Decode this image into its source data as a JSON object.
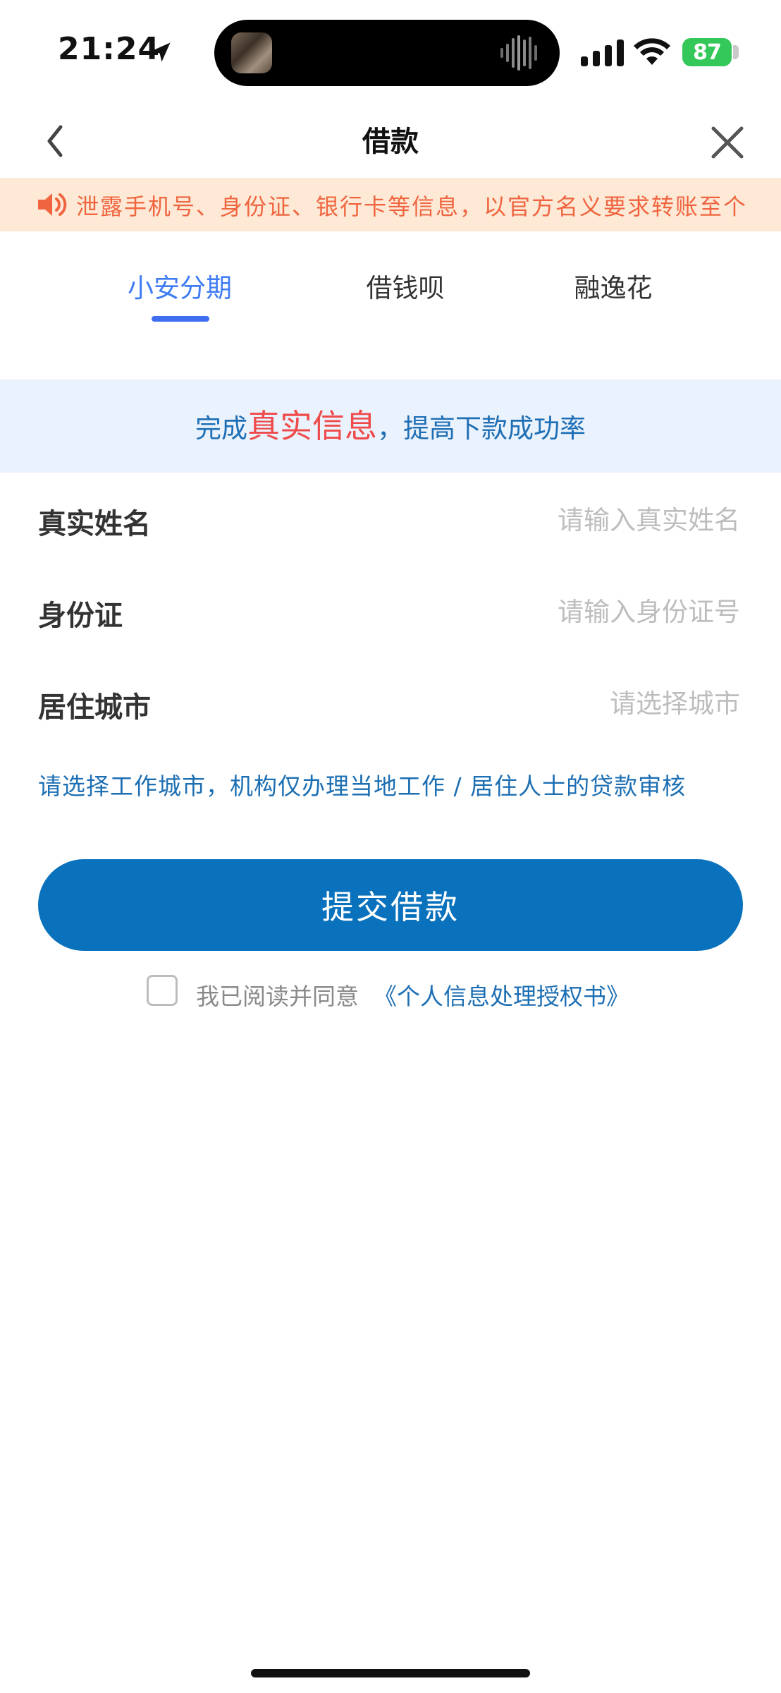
{
  "status_bar": {
    "time": "21:24",
    "battery": "87",
    "battery_color": "#34c759"
  },
  "nav": {
    "title": "借款",
    "back_icon": "chevron-left-icon",
    "close_icon": "close-icon"
  },
  "notice": {
    "icon": "speaker-icon",
    "text": "泄露手机号、身份证、银行卡等信息，以官方名义要求转账至个"
  },
  "tabs": [
    {
      "label": "小安分期",
      "active": true
    },
    {
      "label": "借钱呗",
      "active": false
    },
    {
      "label": "融逸花",
      "active": false
    }
  ],
  "info_banner": {
    "prefix": "完成",
    "highlight": "真实信息",
    "suffix": "，提高下款成功率"
  },
  "form": {
    "name": {
      "label": "真实姓名",
      "placeholder": "请输入真实姓名"
    },
    "id_card": {
      "label": "身份证",
      "placeholder": "请输入身份证号"
    },
    "city": {
      "label": "居住城市",
      "placeholder": "请选择城市"
    }
  },
  "hint": "请选择工作城市，机构仅办理当地工作 / 居住人士的贷款审核",
  "submit_label": "提交借款",
  "agreement": {
    "text": "我已阅读并同意",
    "link": "《个人信息处理授权书》",
    "checked": false
  },
  "colors": {
    "accent_blue": "#0a72bd",
    "tab_active": "#3f7cf4",
    "notice_text": "#f0653f",
    "highlight_red": "#ef4b4b"
  }
}
